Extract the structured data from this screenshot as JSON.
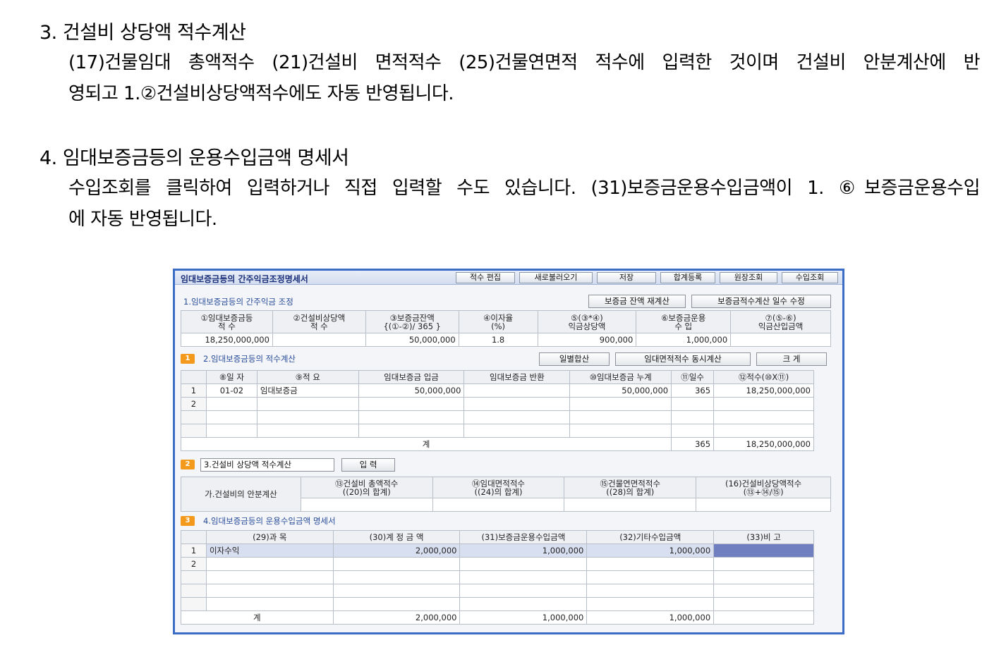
{
  "doc": {
    "sec3_title": "3. 건설비 상당액 적수계산",
    "sec3_line1": "(17)건물임대 총액적수  (21)건설비 면적적수  (25)건물연면적 적수에 입력한 것이며 건설비 안분계산에 반",
    "sec3_line2": "영되고 1.②건설비상당액적수에도 자동 반영됩니다.",
    "sec4_title": "4. 임대보증금등의 운용수입금액 명세서",
    "sec4_line1": "수입조회를 클릭하여 입력하거나 직접 입력할 수도 있습니다. (31)보증금운용수입금액이 1. ⑥보증금운용수입",
    "sec4_line2": "에 자동 반영됩니다."
  },
  "window": {
    "title": "임대보증금등의 간주익금조정명세서",
    "toolbar": [
      "적수 편집",
      "새로불러오기",
      "저장",
      "합계등록",
      "원장조회",
      "수입조회"
    ]
  },
  "s1": {
    "title": "1.임대보증금등의 간주익금 조정",
    "btn_recalc": "보증금 잔액 재계산",
    "btn_days": "보증금적수계산 일수 수정",
    "headers": [
      [
        "①임대보증금등",
        "적          수"
      ],
      [
        "②건설비상당액",
        "적          수"
      ],
      [
        "③보증금잔액",
        "{(①-②)/ 365 }"
      ],
      [
        "④이자율",
        "(%)"
      ],
      [
        "⑤(③*④)",
        "익금상당액"
      ],
      [
        "⑥보증금운용",
        "수          입"
      ],
      [
        "⑦(⑤-⑥)",
        "익금산입금액"
      ]
    ],
    "values": [
      "18,250,000,000",
      "",
      "50,000,000",
      "1.8",
      "900,000",
      "1,000,000",
      ""
    ]
  },
  "s2": {
    "badge": "1",
    "title": "2.임대보증금등의 적수계산",
    "btn_daily": "일별합산",
    "btn_area": "임대면적적수 동시계산",
    "btn_big": "크  게",
    "headers": [
      "⑧일 자",
      "⑨적    요",
      "임대보증금 입금",
      "임대보증금 반환",
      "⑩임대보증금 누계",
      "⑪일수",
      "⑫적수(⑩X⑪)"
    ],
    "rows": [
      [
        "1",
        "01-02",
        "임대보증금",
        "50,000,000",
        "",
        "50,000,000",
        "365",
        "18,250,000,000"
      ],
      [
        "2",
        "",
        "",
        "",
        "",
        "",
        "",
        ""
      ],
      [
        "",
        "",
        "",
        "",
        "",
        "",
        "",
        ""
      ],
      [
        "",
        "",
        "",
        "",
        "",
        "",
        "",
        ""
      ]
    ],
    "total_label": "계",
    "total_days": "365",
    "total_sum": "18,250,000,000"
  },
  "s3": {
    "badge": "2",
    "title": "3.건설비 상당액 적수계산",
    "btn_input": "입 력",
    "row_label": "가.건설비의 안분계산",
    "headers": [
      [
        "⑬건설비 총액적수",
        "((20)의 합계)"
      ],
      [
        "⑭임대면적적수",
        "((24)의 합계)"
      ],
      [
        "⑮건물연면적적수",
        "((28)의 합계)"
      ],
      [
        "(16)건설비상당액적수",
        "(⑬+⑭/⑮)"
      ]
    ]
  },
  "s4": {
    "badge": "3",
    "title": "4.임대보증금등의 운용수입금액 명세서",
    "headers": [
      "(29)과        목",
      "(30)계 정 금 액",
      "(31)보증금운용수입금액",
      "(32)기타수입금액",
      "(33)비       고"
    ],
    "rows": [
      [
        "1",
        "이자수익",
        "2,000,000",
        "1,000,000",
        "1,000,000",
        ""
      ],
      [
        "2",
        "",
        "",
        "",
        "",
        ""
      ],
      [
        "",
        "",
        "",
        "",
        "",
        ""
      ],
      [
        "",
        "",
        "",
        "",
        "",
        ""
      ],
      [
        "",
        "",
        "",
        "",
        "",
        ""
      ]
    ],
    "total_label": "계",
    "totals": [
      "2,000,000",
      "1,000,000",
      "1,000,000"
    ]
  }
}
